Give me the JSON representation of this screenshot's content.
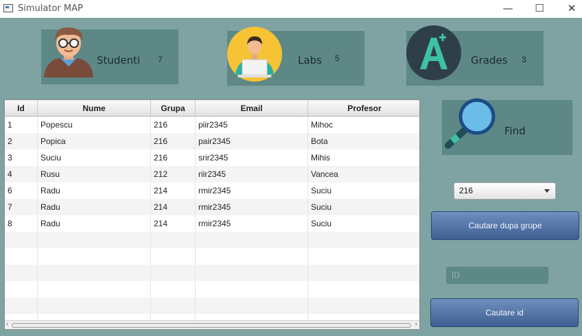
{
  "window": {
    "title": "Simulator MAP",
    "minimize": "—",
    "maximize": "☐",
    "close": "✕"
  },
  "cards": {
    "studenti": {
      "label": "Studenti",
      "count": "7"
    },
    "labs": {
      "label": "Labs",
      "count": "5"
    },
    "grades": {
      "label": "Grades",
      "count": "3"
    },
    "find": {
      "label": "Find"
    }
  },
  "table": {
    "columns": [
      "Id",
      "Nume",
      "Grupa",
      "Email",
      "Profesor"
    ],
    "rows": [
      {
        "id": "1",
        "nume": "Popescu",
        "grupa": "216",
        "email": "piir2345",
        "profesor": "Mihoc"
      },
      {
        "id": "2",
        "nume": "Popica",
        "grupa": "216",
        "email": "pair2345",
        "profesor": "Bota"
      },
      {
        "id": "3",
        "nume": "Suciu",
        "grupa": "216",
        "email": "srir2345",
        "profesor": "Mihis"
      },
      {
        "id": "4",
        "nume": "Rusu",
        "grupa": "212",
        "email": "riir2345",
        "profesor": "Vancea"
      },
      {
        "id": "6",
        "nume": "Radu",
        "grupa": "214",
        "email": "rmir2345",
        "profesor": "Suciu"
      },
      {
        "id": "7",
        "nume": "Radu",
        "grupa": "214",
        "email": "rmir2345",
        "profesor": "Suciu"
      },
      {
        "id": "8",
        "nume": "Radu",
        "grupa": "214",
        "email": "rmir2345",
        "profesor": "Suciu"
      }
    ]
  },
  "search": {
    "group_selected": "216",
    "group_button": "Cautare dupa grupe",
    "id_placeholder": "ID",
    "id_button": "Cautare id"
  },
  "colors": {
    "background": "#7ea3a2",
    "card": "#5d8886",
    "button": "#4f6fa3"
  },
  "icons": {
    "students": "student-avatar-icon",
    "labs": "lab-laptop-icon",
    "grades": "grade-a-plus-icon",
    "find": "magnifier-icon"
  }
}
